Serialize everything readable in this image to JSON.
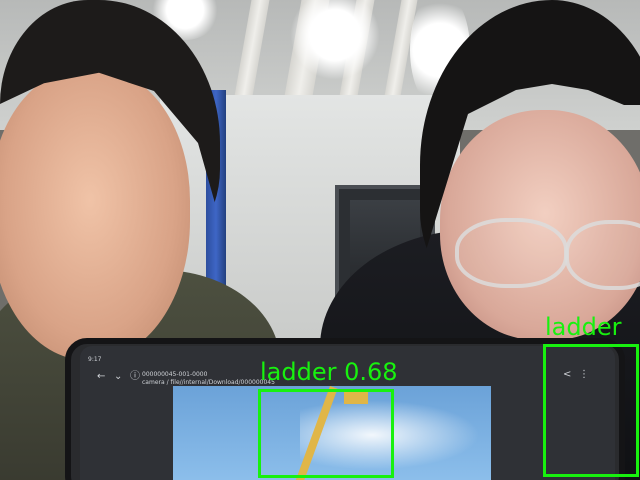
{
  "tablet": {
    "status_time": "9:17",
    "url_line1": "000000045-001-0000",
    "url_line2": "camera / file//internal/Download/000000045"
  },
  "detections": [
    {
      "label": "ladder",
      "score": "0.68",
      "text": "ladder 0.68"
    },
    {
      "label": "ladder",
      "score": "",
      "text": "ladder"
    }
  ],
  "colors": {
    "bbox": "#18f10f"
  }
}
